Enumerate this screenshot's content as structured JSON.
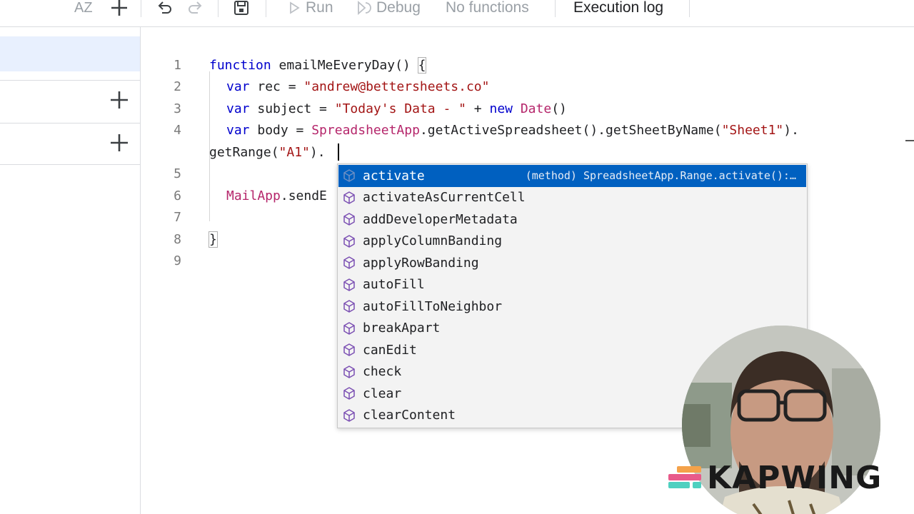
{
  "toolbar": {
    "sort_label": "AZ",
    "run_label": "Run",
    "debug_label": "Debug",
    "function_select": "No functions",
    "execution_log_label": "Execution log",
    "icons": [
      "sort-az-icon",
      "add-icon",
      "undo-icon",
      "redo-icon",
      "save-icon",
      "play-icon",
      "debug-icon"
    ]
  },
  "sidebar": {
    "icons": [
      "add-icon",
      "add-icon"
    ]
  },
  "editor": {
    "line_numbers": [
      "1",
      "2",
      "3",
      "4",
      "5",
      "6",
      "7",
      "8",
      "9"
    ],
    "code": {
      "l1_kw": "function",
      "l1_rest": " emailMeEveryDay() ",
      "l1_brace": "{",
      "l2_kw": "var",
      "l2_mid": " rec = ",
      "l2_str": "\"andrew@bettersheets.co\"",
      "l3_kw": "var",
      "l3_mid": " subject = ",
      "l3_str": "\"Today's Data - \"",
      "l3_plus": " + ",
      "l3_new": "new",
      "l3_space": " ",
      "l3_cls": "Date",
      "l3_end": "()",
      "l4_kw": "var",
      "l4_mid": " body = ",
      "l4_cls": "SpreadsheetApp",
      "l4_call": ".getActiveSpreadsheet().getSheetByName(",
      "l4_str": "\"Sheet1\"",
      "l4_end": ").",
      "l4b_call": "getRange(",
      "l4b_str": "\"A1\"",
      "l4b_end": ").",
      "l6_cls": "MailApp",
      "l6_rest": ".sendE",
      "l8_brace": "}"
    }
  },
  "autocomplete": {
    "items": [
      {
        "label": "activate",
        "detail": "(method) SpreadsheetApp.Range.activate():…"
      },
      {
        "label": "activateAsCurrentCell"
      },
      {
        "label": "addDeveloperMetadata"
      },
      {
        "label": "applyColumnBanding"
      },
      {
        "label": "applyRowBanding"
      },
      {
        "label": "autoFill"
      },
      {
        "label": "autoFillToNeighbor"
      },
      {
        "label": "breakApart"
      },
      {
        "label": "canEdit"
      },
      {
        "label": "check"
      },
      {
        "label": "clear"
      },
      {
        "label": "clearContent"
      }
    ],
    "selected_index": 0,
    "item_icon": "cube-method-icon",
    "selection_color": "#0060c0"
  },
  "overlay": {
    "watermark": "KAPWING",
    "webcam_icon": "webcam-person"
  }
}
